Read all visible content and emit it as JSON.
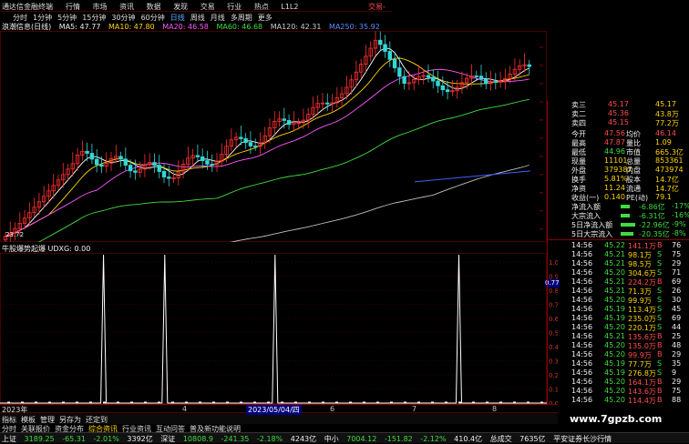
{
  "app": {
    "title": "通达信金融终端",
    "menu": [
      "行情",
      "市场",
      "资讯",
      "数据",
      "发现",
      "交易",
      "行业",
      "热点",
      "L1L2"
    ],
    "trade_label": "交易-"
  },
  "period_tabs": [
    {
      "label": "分时",
      "selected": false
    },
    {
      "label": "1分钟",
      "selected": false
    },
    {
      "label": "5分钟",
      "selected": false
    },
    {
      "label": "15分钟",
      "selected": false
    },
    {
      "label": "30分钟",
      "selected": false
    },
    {
      "label": "60分钟",
      "selected": false
    },
    {
      "label": "日线",
      "selected": true
    },
    {
      "label": "周线",
      "selected": false
    },
    {
      "label": "月线",
      "selected": false
    },
    {
      "label": "多周期",
      "selected": false
    },
    {
      "label": "更多",
      "selected": false
    }
  ],
  "ma_legend": {
    "stock": "浪潮信息(日线)",
    "ma5": "MA5: 47.77",
    "ma10": "MA10: 47.80",
    "ma20": "MA20: 46.58",
    "ma60": "MA60: 46.68",
    "ma120": "MA120: 42.31",
    "ma250": "MA250: 35.92"
  },
  "colors": {
    "up": "#ff3030",
    "down": "#33d7d7",
    "ma5": "#ffffff",
    "ma10": "#ffd500",
    "ma20": "#ff55ff",
    "ma60": "#3fdc3f",
    "ma120": "#c0c0c0",
    "ma250": "#4060ff"
  },
  "price_axis": [
    "50.00",
    "47.50",
    "45.00",
    "42.50",
    "40.00",
    "37.50",
    "35.00",
    "32.50",
    "30.00",
    "27.50",
    "25.00"
  ],
  "low_label": "23.72",
  "indicator": {
    "legend": "牛股爆势起爆 UDXG: 0.00",
    "scale_top": "0.77",
    "axis": [
      "1.00",
      "0.90",
      "0.80",
      "0.70",
      "0.60",
      "0.50",
      "0.40",
      "0.30",
      "0.20",
      "0.10",
      "0.00"
    ]
  },
  "spikes": [
    8,
    13,
    22,
    37
  ],
  "date_axis": {
    "start": "2023年",
    "marker": "2023/05/04/四",
    "ticks": [
      "4",
      "5",
      "6",
      "7",
      "8"
    ]
  },
  "quote": {
    "ask": [
      {
        "label": "卖三",
        "price": "45.17",
        "vol": "45.17"
      },
      {
        "label": "卖二",
        "price": "45.36",
        "vol": "43.8万"
      },
      {
        "label": "卖四",
        "price": "45.15",
        "vol": "77.2万"
      }
    ],
    "rows": [
      {
        "l1": "今开",
        "v1": "47.56",
        "l2": "均价",
        "v2": "46.14"
      },
      {
        "l1": "最高",
        "v1": "47.87",
        "l2": "量比",
        "v2": "1.09"
      },
      {
        "l1": "最低",
        "v1": "44.96",
        "l2": "市值",
        "v2": "665.3亿"
      },
      {
        "l1": "现量",
        "v1": "11101",
        "l2": "总量",
        "v2": "853361"
      },
      {
        "l1": "外盘",
        "v1": "379387",
        "l2": "内盘",
        "v2": "473974"
      },
      {
        "l1": "换手",
        "v1": "5.81%",
        "l2": "股本",
        "v2": "14.7亿"
      },
      {
        "l1": "净资",
        "v1": "11.24",
        "l2": "流通",
        "v2": "14.7亿"
      },
      {
        "l1": "收益(一)",
        "v1": "0.140",
        "l2": "PE(动)",
        "v2": "79.1"
      }
    ],
    "flows": [
      {
        "label": "净流入额",
        "value": "-6.86亿",
        "pct": "-17%"
      },
      {
        "label": "大宗流入",
        "value": "-6.31亿",
        "pct": "-16%"
      },
      {
        "label": "5日净流入额",
        "value": "-22.96亿",
        "pct": "-9%"
      },
      {
        "label": "5日大宗流入",
        "value": "-20.35亿",
        "pct": "-8%"
      }
    ],
    "ticks": [
      {
        "t": "14:56",
        "p": "45.22",
        "v": "141.1万",
        "d": "B",
        "n": "76"
      },
      {
        "t": "14:56",
        "p": "45.21",
        "v": "98.1万",
        "d": "S",
        "n": "75"
      },
      {
        "t": "14:56",
        "p": "45.21",
        "v": "98.5万",
        "d": "S",
        "n": "29"
      },
      {
        "t": "14:56",
        "p": "45.20",
        "v": "304.6万",
        "d": "S",
        "n": "71"
      },
      {
        "t": "14:56",
        "p": "45.21",
        "v": "224.2万",
        "d": "B",
        "n": "69"
      },
      {
        "t": "14:56",
        "p": "45.21",
        "v": "71.3万",
        "d": "S",
        "n": "26"
      },
      {
        "t": "14:56",
        "p": "45.20",
        "v": "99.9万",
        "d": "S",
        "n": "30"
      },
      {
        "t": "14:56",
        "p": "45.19",
        "v": "113.4万",
        "d": "S",
        "n": "45"
      },
      {
        "t": "14:56",
        "p": "45.19",
        "v": "235.0万",
        "d": "S",
        "n": "69"
      },
      {
        "t": "14:56",
        "p": "45.20",
        "v": "220.1万",
        "d": "S",
        "n": "44"
      },
      {
        "t": "14:56",
        "p": "45.21",
        "v": "135.6万",
        "d": "B",
        "n": "25"
      },
      {
        "t": "14:56",
        "p": "45.20",
        "v": "135.0万",
        "d": "B",
        "n": "48"
      },
      {
        "t": "14:56",
        "p": "45.20",
        "v": "99.9万",
        "d": "B",
        "n": "29"
      },
      {
        "t": "14:56",
        "p": "45.19",
        "v": "77.7万",
        "d": "S",
        "n": "35"
      },
      {
        "t": "14:56",
        "p": "45.19",
        "v": "276.8万",
        "d": "S",
        "n": "9"
      },
      {
        "t": "14:56",
        "p": "45.20",
        "v": "164.1万",
        "d": "B",
        "n": "29"
      },
      {
        "t": "14:56",
        "p": "45.20",
        "v": "143.6万",
        "d": "B",
        "n": "75"
      },
      {
        "t": "14:56",
        "p": "45.20",
        "v": "114.4万",
        "d": "B",
        "n": "88"
      }
    ]
  },
  "bottom_tabs": [
    "指标",
    "模板",
    "管理",
    "另存为",
    "还定到"
  ],
  "info_tabs": [
    "分时",
    "关联报价",
    "资金分布",
    "综合资讯",
    "行业资讯",
    "互动问答",
    "普及新功能说明"
  ],
  "status": {
    "sh_label": "上证",
    "sh_val": "3189.25",
    "sh_chg": "-65.31",
    "sh_pct": "-2.01%",
    "sh_amt": "3392亿",
    "sz_label": "深证",
    "sz_val": "10808.9",
    "sz_chg": "-241.35",
    "sz_pct": "-2.18%",
    "sz_amt": "4243亿",
    "zx_label": "中小",
    "zx_val": "7004.12",
    "zx_chg": "-151.82",
    "zx_pct": "-2.12%",
    "zx_amt": "410.4亿",
    "total_label": "总成交",
    "total_amt": "7635亿",
    "broker": "平安证券长沙行情"
  },
  "watermark": "www.7gpzb.com"
}
